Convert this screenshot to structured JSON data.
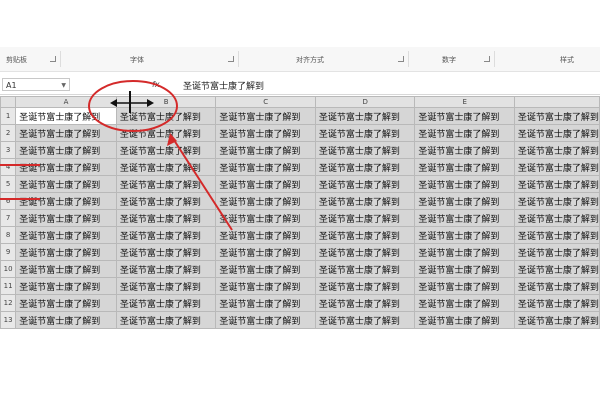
{
  "ribbon": {
    "groups": [
      {
        "label": "剪贴板",
        "has_launcher": true
      },
      {
        "label": "字体",
        "has_launcher": true
      },
      {
        "label": "对齐方式",
        "has_launcher": true
      },
      {
        "label": "数字",
        "has_launcher": true
      },
      {
        "label": "样式",
        "has_launcher": false
      }
    ]
  },
  "formula_bar": {
    "name_box": "A1",
    "fx": "fx",
    "content": "圣诞节富士康了解到"
  },
  "grid": {
    "columns": [
      "A",
      "B",
      "C",
      "D",
      "E",
      ""
    ],
    "rows": [
      "1",
      "2",
      "3",
      "4",
      "5",
      "6",
      "7",
      "8",
      "9",
      "10",
      "11",
      "12",
      "13"
    ],
    "cell_text": "圣诞节富士康了解到",
    "active_cell": "A1"
  },
  "annotations": {
    "cursor_icon": "column-resize-cursor-icon",
    "circle_color": "#d42a2a",
    "arrow_color": "#d42a2a",
    "marker_color": "#d42a2a"
  }
}
